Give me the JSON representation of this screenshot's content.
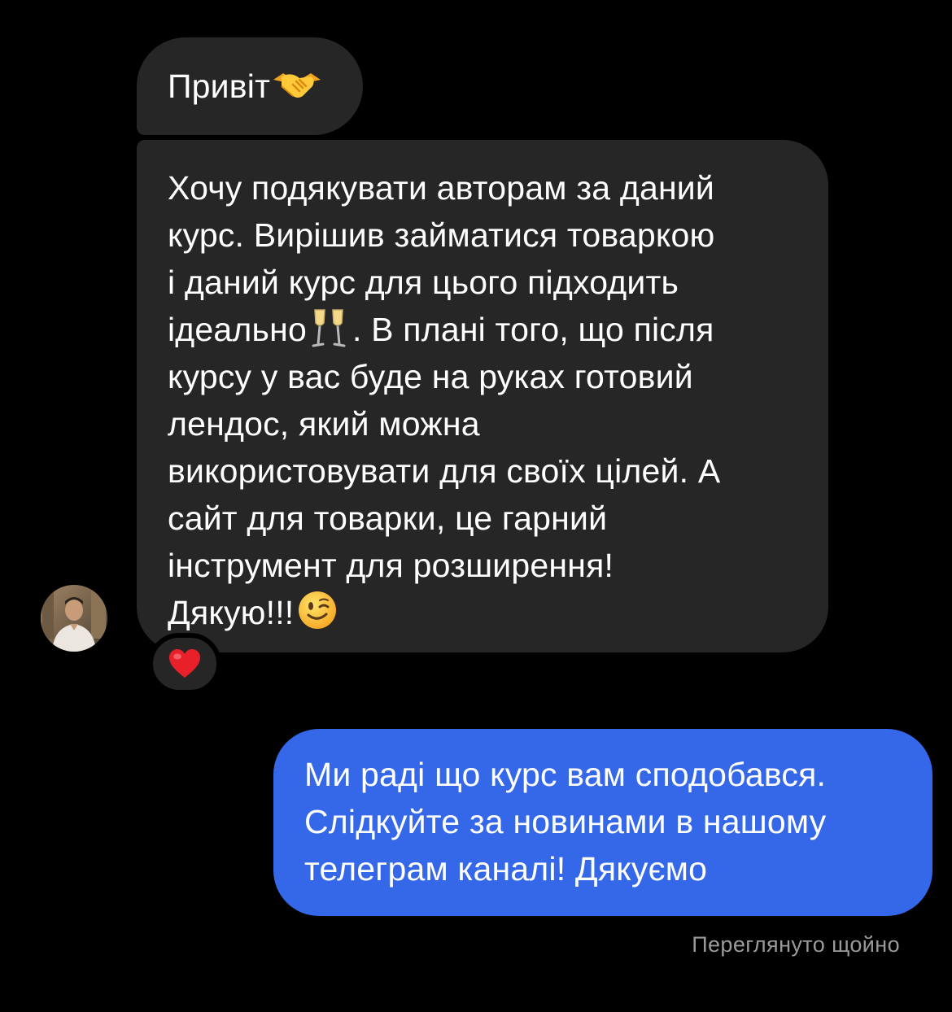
{
  "conversation": {
    "messages": [
      {
        "direction": "incoming",
        "lines": [
          "Привіт"
        ],
        "emoji": "handshake"
      },
      {
        "direction": "incoming",
        "lines": [
          "Хочу подякувати авторам за даний",
          "курс. Вирішив займатися товаркою",
          "і даний курс для цього підходить",
          "ідеально",
          ". В плані того, що після",
          "курсу у вас буде на руках готовий",
          "лендос, який можна",
          "використовувати для своїх цілей. А",
          "сайт для товарки, це гарний",
          "інструмент для розширення!",
          "Дякую!!!"
        ],
        "reaction": "red-heart",
        "emojis": [
          "clinking-glasses",
          "winking-face"
        ]
      },
      {
        "direction": "outgoing",
        "lines": [
          "Ми раді що курс вам сподобався.",
          "Слідкуйте за новинами в нашому",
          "телеграм каналі! Дякуємо"
        ]
      }
    ],
    "seen_status": "Переглянуто щойно"
  },
  "colors": {
    "background": "#000000",
    "incoming_bubble": "#262626",
    "outgoing_bubble": "#3568e8",
    "seen_text": "#9a9a9a"
  }
}
